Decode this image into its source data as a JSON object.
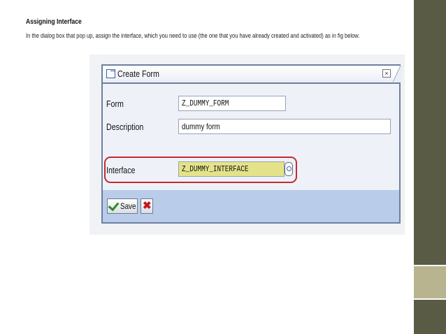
{
  "slide": {
    "heading": "Assigning Interface",
    "intro": "In the dialog box that pop up, assign the interface, which you need to use (the one that you have already created and activated) as in fig below."
  },
  "dialog": {
    "title": "Create Form",
    "close_glyph": "×",
    "fields": {
      "form": {
        "label": "Form",
        "value": "Z_DUMMY_FORM"
      },
      "description": {
        "label": "Description",
        "value": "dummy form"
      },
      "interface": {
        "label": "Interface",
        "value": "Z_DUMMY_INTERFACE"
      }
    },
    "buttons": {
      "save_label": "Save",
      "cancel_glyph": "✖"
    }
  },
  "colors": {
    "highlight": "#c52a33",
    "interface_field": "#e4e38a",
    "footer": "#b9cdea",
    "accent_dark": "#5a5b44",
    "accent_light": "#b8b48f"
  }
}
